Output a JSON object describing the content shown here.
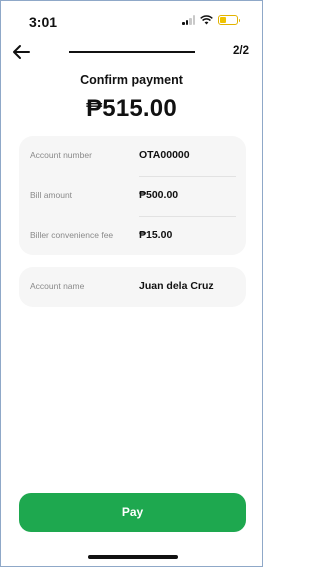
{
  "status_bar": {
    "time": "3:01"
  },
  "header": {
    "step": "2/2"
  },
  "confirm": {
    "title": "Confirm payment",
    "total_amount": "₱515.00"
  },
  "details": [
    {
      "label": "Account number",
      "value": "OTA00000"
    },
    {
      "label": "Bill amount",
      "value": "₱500.00"
    },
    {
      "label": "Biller convenience fee",
      "value": "₱15.00"
    }
  ],
  "account": {
    "label": "Account name",
    "value": "Juan dela Cruz"
  },
  "actions": {
    "pay_label": "Pay"
  },
  "colors": {
    "accent": "#1ea84f",
    "card_bg": "#f6f6f6"
  },
  "icons": {
    "back": "arrow-left-icon",
    "wifi": "wifi-icon",
    "signal": "signal-icon",
    "battery": "battery-icon"
  }
}
